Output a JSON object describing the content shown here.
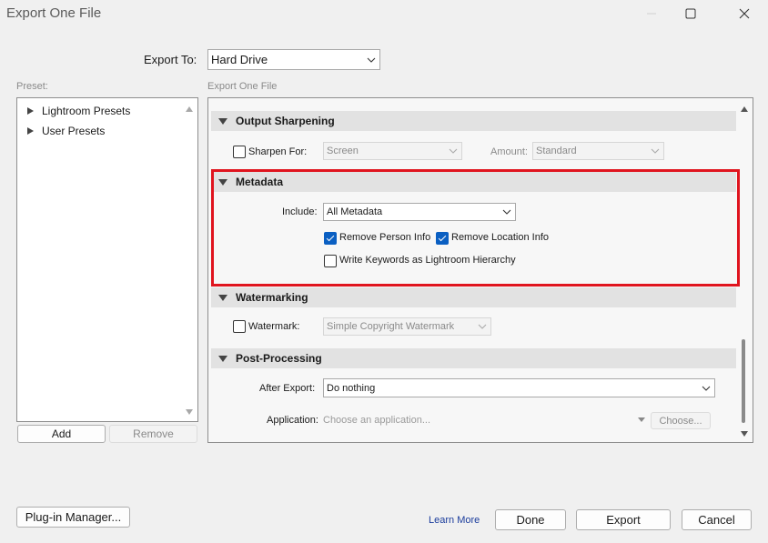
{
  "window": {
    "title": "Export One File"
  },
  "export_to": {
    "label": "Export To:",
    "value": "Hard Drive"
  },
  "preset_panel": {
    "label": "Preset:",
    "items": [
      {
        "label": "Lightroom Presets"
      },
      {
        "label": "User Presets"
      }
    ],
    "add_label": "Add",
    "remove_label": "Remove"
  },
  "main_panel": {
    "label": "Export One File",
    "output_sharpening": {
      "title": "Output Sharpening",
      "sharpen_for_label": "Sharpen For:",
      "sharpen_for_value": "Screen",
      "amount_label": "Amount:",
      "amount_value": "Standard"
    },
    "metadata": {
      "title": "Metadata",
      "include_label": "Include:",
      "include_value": "All Metadata",
      "remove_person_label": "Remove Person Info",
      "remove_location_label": "Remove Location Info",
      "write_keywords_label": "Write Keywords as Lightroom Hierarchy"
    },
    "watermarking": {
      "title": "Watermarking",
      "watermark_label": "Watermark:",
      "watermark_value": "Simple Copyright Watermark"
    },
    "post_processing": {
      "title": "Post-Processing",
      "after_export_label": "After Export:",
      "after_export_value": "Do nothing",
      "application_label": "Application:",
      "application_placeholder": "Choose an application...",
      "choose_label": "Choose..."
    }
  },
  "footer": {
    "plugin_manager_label": "Plug-in Manager...",
    "learn_more_label": "Learn More",
    "done_label": "Done",
    "export_label": "Export",
    "cancel_label": "Cancel"
  },
  "colors": {
    "highlight": "#e0141e",
    "checkbox_on": "#0a5fc2",
    "link": "#1a3c9c"
  },
  "icons": [
    "minimize-icon",
    "maximize-icon",
    "close-icon",
    "chevron-down-icon",
    "triangle-right-icon",
    "triangle-down-icon",
    "scroll-up-icon",
    "scroll-down-icon",
    "checkmark-icon"
  ]
}
